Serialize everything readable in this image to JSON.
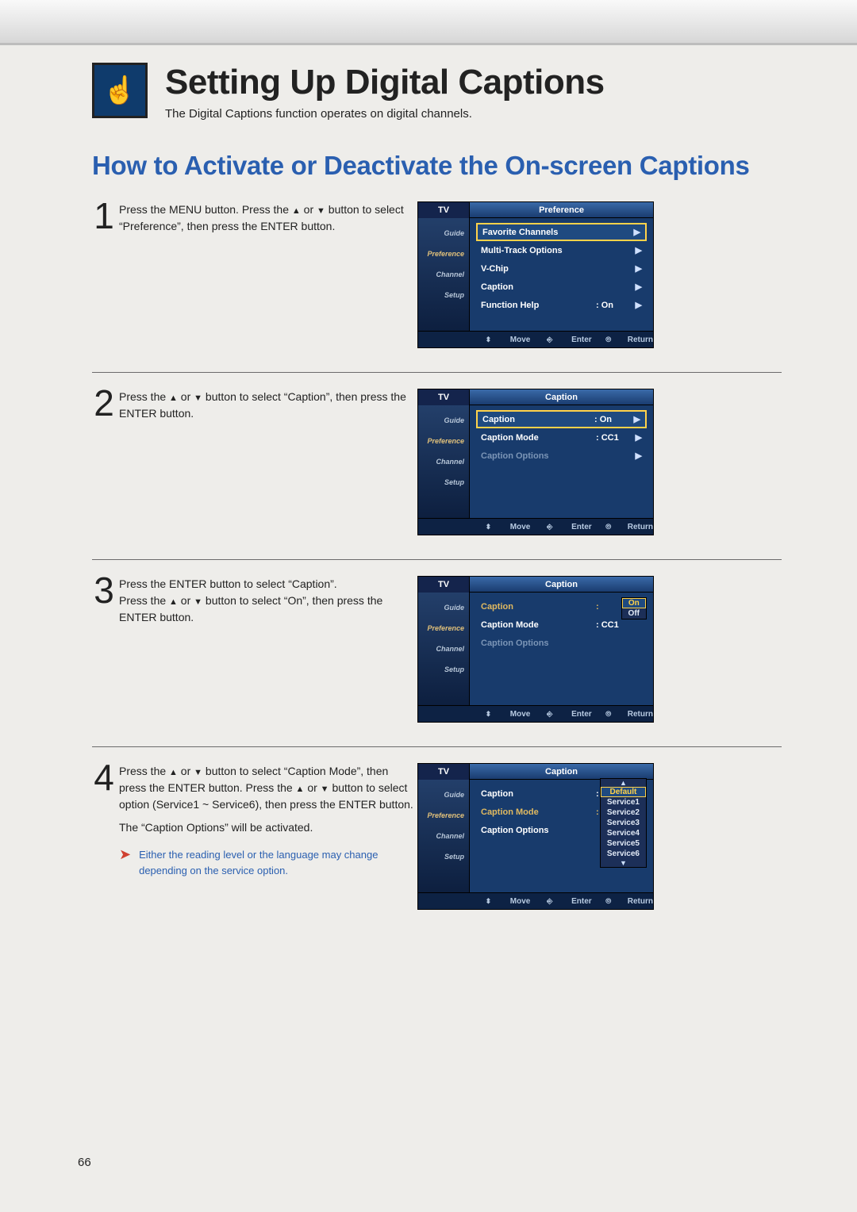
{
  "header": {
    "title": "Setting Up Digital Captions",
    "subtitle": "The Digital Captions function operates on digital channels."
  },
  "section_heading": "How to Activate or Deactivate the On-screen Captions",
  "steps": [
    {
      "num": "1",
      "text_before": "Press the MENU button. Press the ",
      "text_mid": " or ",
      "text_after": " button to select “Preference”, then press the ENTER button."
    },
    {
      "num": "2",
      "text_before": "Press the ",
      "text_mid": " or ",
      "text_after": " button to select “Caption”, then press the ENTER button."
    },
    {
      "num": "3",
      "line1": "Press the ENTER button to select “Caption”.",
      "text_before": "Press the ",
      "text_mid": " or ",
      "text_after": " button to select “On”, then press the ENTER button."
    },
    {
      "num": "4",
      "l1_before": "Press the ",
      "l1_mid": " or ",
      "l1_after": " button to select “Caption Mode”, then press the ENTER button. Press the ",
      "l1_mid2": " or ",
      "l1_after2": " button to select option (Service1 ~ Service6), then press the ENTER button.",
      "line2": "The “Caption Options” will be activated.",
      "hint": "Either the reading level or the language may change depending on the service option."
    }
  ],
  "osd_common": {
    "tv": "TV",
    "side": [
      "Guide",
      "Preference",
      "Channel",
      "Setup"
    ],
    "footer_move": "Move",
    "footer_enter": "Enter",
    "footer_return": "Return"
  },
  "osd1": {
    "title": "Preference",
    "rows": [
      {
        "label": "Favorite Channels",
        "val": "",
        "caret": "▶",
        "sel": true
      },
      {
        "label": "Multi-Track Options",
        "val": "",
        "caret": "▶"
      },
      {
        "label": "V-Chip",
        "val": "",
        "caret": "▶"
      },
      {
        "label": "Caption",
        "val": "",
        "caret": "▶"
      },
      {
        "label": "Function Help",
        "val": ": On",
        "caret": "▶"
      }
    ]
  },
  "osd2": {
    "title": "Caption",
    "rows": [
      {
        "label": "Caption",
        "val": ": On",
        "caret": "▶",
        "sel": true
      },
      {
        "label": "Caption Mode",
        "val": ": CC1",
        "caret": "▶"
      },
      {
        "label": "Caption Options",
        "val": "",
        "caret": "▶",
        "dim": true
      }
    ]
  },
  "osd3": {
    "title": "Caption",
    "rows": [
      {
        "label": "Caption",
        "val": ":",
        "amber": true
      },
      {
        "label": "Caption Mode",
        "val": ": CC1"
      },
      {
        "label": "Caption Options",
        "val": "",
        "dim": true
      }
    ],
    "popup": [
      "On",
      "Off"
    ],
    "popup_sel": 0
  },
  "osd4": {
    "title": "Caption",
    "rows": [
      {
        "label": "Caption",
        "val": ":"
      },
      {
        "label": "Caption Mode",
        "val": ":",
        "amber": true
      },
      {
        "label": "Caption Options",
        "val": ""
      }
    ],
    "popup": [
      "Default",
      "Service1",
      "Service2",
      "Service3",
      "Service4",
      "Service5",
      "Service6"
    ],
    "popup_sel": 0
  },
  "page_number": "66",
  "glyphs": {
    "up": "▲",
    "down": "▼",
    "right": "▶",
    "updown": "▲▼",
    "enter": "↵",
    "return": "←"
  }
}
